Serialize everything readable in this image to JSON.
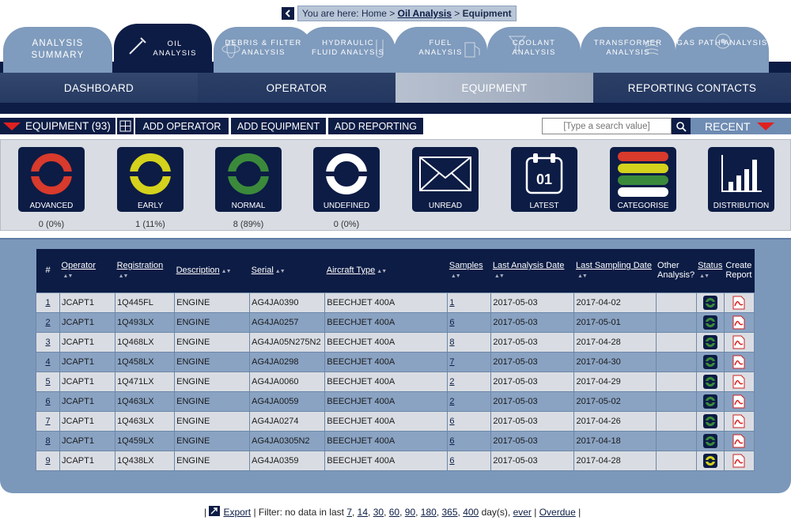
{
  "breadcrumb": {
    "prefix": "You are here: ",
    "home": "Home",
    "sep1": " > ",
    "section": "Oil Analysis",
    "sep2": " > ",
    "current": "Equipment"
  },
  "analysis_tabs": [
    {
      "label1": "ANALYSIS",
      "label2": "SUMMARY"
    },
    {
      "label1": "OIL",
      "label2": "ANALYSIS"
    },
    {
      "label1": "DEBRIS & FILTER",
      "label2": "ANALYSIS"
    },
    {
      "label1": "HYDRAULIC",
      "label2": "FLUID ANALYSIS"
    },
    {
      "label1": "FUEL",
      "label2": "ANALYSIS"
    },
    {
      "label1": "COOLANT",
      "label2": "ANALYSIS"
    },
    {
      "label1": "TRANSFORMER",
      "label2": "ANALYSIS"
    },
    {
      "label1": "",
      "label2": "GAS PATH ANALYSIS"
    }
  ],
  "main_nav": [
    "DASHBOARD",
    "OPERATOR",
    "EQUIPMENT",
    "REPORTING CONTACTS"
  ],
  "toolbar": {
    "equipment": "EQUIPMENT (93)",
    "add_operator": "ADD OPERATOR",
    "add_equipment": "ADD EQUIPMENT",
    "add_reporting": "ADD REPORTING",
    "search_placeholder": "[Type a search value]",
    "recent": "RECENT"
  },
  "status_tiles": [
    {
      "label": "ADVANCED",
      "count": "0 (0%)",
      "color": "#d83a2c"
    },
    {
      "label": "EARLY",
      "count": "1 (11%)",
      "color": "#d4d21c"
    },
    {
      "label": "NORMAL",
      "count": "8 (89%)",
      "color": "#3b8a3b"
    },
    {
      "label": "UNDEFINED",
      "count": "0 (0%)",
      "color": "#ffffff"
    },
    {
      "label": "UNREAD",
      "count": ""
    },
    {
      "label": "LATEST",
      "count": "",
      "day": "01"
    },
    {
      "label": "CATEGORISE",
      "count": ""
    },
    {
      "label": "DISTRIBUTION",
      "count": ""
    }
  ],
  "table": {
    "headers": {
      "num": "#",
      "operator": "Operator",
      "registration": "Registration",
      "description": "Description",
      "serial": "Serial",
      "aircraft": "Aircraft Type",
      "samples": "Samples",
      "last_analysis": "Last Analysis Date",
      "last_sampling": "Last Sampling Date",
      "other1": "Other",
      "other2": "Analysis?",
      "status": "Status",
      "create1": "Create",
      "create2": "Report"
    },
    "rows": [
      {
        "n": "1",
        "op": "JCAPT1",
        "reg": "1Q445FL",
        "desc": "ENGINE",
        "serial": "AG4JA0390",
        "ac": "BEECHJET 400A",
        "samples": "1",
        "la": "2017-05-03",
        "ls": "2017-04-02",
        "status": "normal"
      },
      {
        "n": "2",
        "op": "JCAPT1",
        "reg": "1Q493LX",
        "desc": "ENGINE",
        "serial": "AG4JA0257",
        "ac": "BEECHJET 400A",
        "samples": "6",
        "la": "2017-05-03",
        "ls": "2017-05-01",
        "status": "normal"
      },
      {
        "n": "3",
        "op": "JCAPT1",
        "reg": "1Q468LX",
        "desc": "ENGINE",
        "serial": "AG4JA05N275N2",
        "ac": "BEECHJET 400A",
        "samples": "8",
        "la": "2017-05-03",
        "ls": "2017-04-28",
        "status": "normal"
      },
      {
        "n": "4",
        "op": "JCAPT1",
        "reg": "1Q458LX",
        "desc": "ENGINE",
        "serial": "AG4JA0298",
        "ac": "BEECHJET 400A",
        "samples": "7",
        "la": "2017-05-03",
        "ls": "2017-04-30",
        "status": "normal"
      },
      {
        "n": "5",
        "op": "JCAPT1",
        "reg": "1Q471LX",
        "desc": "ENGINE",
        "serial": "AG4JA0060",
        "ac": "BEECHJET 400A",
        "samples": "2",
        "la": "2017-05-03",
        "ls": "2017-04-29",
        "status": "normal"
      },
      {
        "n": "6",
        "op": "JCAPT1",
        "reg": "1Q463LX",
        "desc": "ENGINE",
        "serial": "AG4JA0059",
        "ac": "BEECHJET 400A",
        "samples": "2",
        "la": "2017-05-03",
        "ls": "2017-05-02",
        "status": "normal"
      },
      {
        "n": "7",
        "op": "JCAPT1",
        "reg": "1Q463LX",
        "desc": "ENGINE",
        "serial": "AG4JA0274",
        "ac": "BEECHJET 400A",
        "samples": "6",
        "la": "2017-05-03",
        "ls": "2017-04-26",
        "status": "normal"
      },
      {
        "n": "8",
        "op": "JCAPT1",
        "reg": "1Q459LX",
        "desc": "ENGINE",
        "serial": "AG4JA0305N2",
        "ac": "BEECHJET 400A",
        "samples": "6",
        "la": "2017-05-03",
        "ls": "2017-04-18",
        "status": "normal"
      },
      {
        "n": "9",
        "op": "JCAPT1",
        "reg": "1Q438LX",
        "desc": "ENGINE",
        "serial": "AG4JA0359",
        "ac": "BEECHJET 400A",
        "samples": "6",
        "la": "2017-05-03",
        "ls": "2017-04-28",
        "status": "early"
      }
    ]
  },
  "footer": {
    "bar1": "| ",
    "export": "Export",
    "filter": " | Filter: no data in last ",
    "days": [
      "7",
      "14",
      "30",
      "60",
      "90",
      "180",
      "365",
      "400"
    ],
    "day_suffix": " day(s), ",
    "ever": "ever",
    "bar2": " | ",
    "overdue": "Overdue",
    "bar3": " |"
  }
}
